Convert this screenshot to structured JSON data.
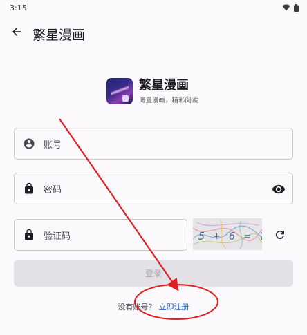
{
  "status_bar": {
    "time": "3:15"
  },
  "app_bar": {
    "title": "繁星漫画"
  },
  "brand": {
    "name": "繁星漫画",
    "slogan": "海量漫画，精彩阅读"
  },
  "form": {
    "username_label": "账号",
    "password_label": "密码",
    "captcha_label": "验证码",
    "captcha_text": "5 + 6 = ?",
    "login_label": "登录"
  },
  "register": {
    "question": "没有账号？",
    "link": "立即注册"
  },
  "colors": {
    "link": "#1f5fc0",
    "annotation": "#e02020",
    "disabled_button": "#e4e1e6"
  },
  "icons": [
    "back-arrow-icon",
    "person-icon",
    "lock-icon",
    "eye-icon",
    "refresh-icon",
    "wifi-icon",
    "battery-icon"
  ]
}
